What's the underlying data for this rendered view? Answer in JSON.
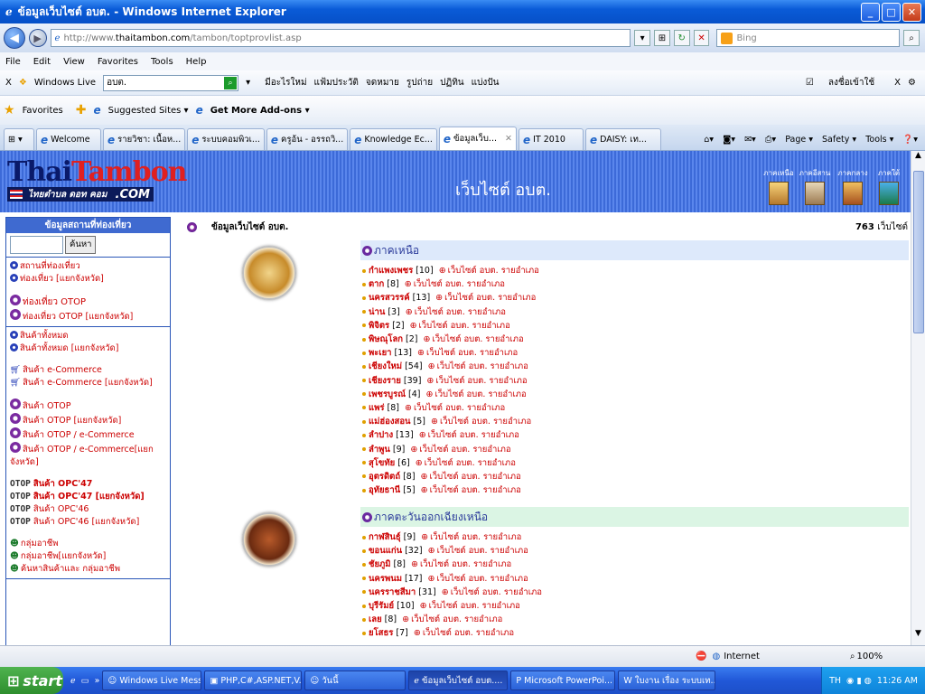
{
  "window": {
    "title": "ข้อมูลเว็บไซต์ อบต. - Windows Internet Explorer"
  },
  "address": {
    "url_prefix": "http://www.",
    "url_domain": "thaitambon.com",
    "url_path": "/tambon/toptprovlist.asp",
    "search_placeholder": "Bing"
  },
  "menu": [
    "File",
    "Edit",
    "View",
    "Favorites",
    "Tools",
    "Help"
  ],
  "wl_toolbar": {
    "brand": "Windows Live",
    "search_value": "อบต.",
    "links": [
      "มีอะไรใหม่",
      "แฟ้มประวัติ",
      "จดหมาย",
      "รูปถ่าย",
      "ปฏิทิน",
      "แบ่งปัน"
    ],
    "signin": "ลงชื่อเข้าใช้"
  },
  "favorites": {
    "label": "Favorites",
    "items": [
      "Suggested Sites ▾",
      "Get More Add-ons ▾"
    ]
  },
  "tabs": [
    "Welcome",
    "รายวิชา: เนื้อห...",
    "ระบบคอมพิวเ...",
    "ครูอ้น - อรรถวิ...",
    "Knowledge Ec...",
    "ข้อมูลเว็บ...",
    "IT 2010",
    "DAISY: เท..."
  ],
  "tab_tools": [
    "Page ▾",
    "Safety ▾",
    "Tools ▾"
  ],
  "header": {
    "logo_thai": "Thai",
    "logo_tambon": "Tambon",
    "logo_tagline": "ไทยตำบล ดอท คอม",
    "logo_com": ".COM",
    "site_title": "เว็บไซต์ อบต.",
    "regions": [
      "ภาคเหนือ",
      "ภาคอีสาน",
      "ภาคกลาง",
      "ภาคใต้"
    ]
  },
  "left": {
    "head": "ข้อมูลสถานที่ท่องเที่ยว",
    "search_btn": "ค้นหา",
    "s1": [
      "สถานที่ท่องเที่ยว",
      "ท่องเที่ยว [แยกจังหวัด]"
    ],
    "s2": [
      "ท่องเที่ยว OTOP",
      "ท่องเที่ยว OTOP [แยกจังหวัด]"
    ],
    "s3": [
      "สินค้าทั้งหมด",
      "สินค้าทั้งหมด [แยกจังหวัด]",
      "สินค้า e-Commerce",
      "สินค้า e-Commerce [แยกจังหวัด]",
      "สินค้า OTOP",
      "สินค้า OTOP [แยกจังหวัด]",
      "สินค้า OTOP / e-Commerce",
      "สินค้า OTOP / e-Commerce[แยกจังหวัด]"
    ],
    "s4": {
      "otop": "OTOP",
      "items": [
        "สินค้า OPC'47",
        "สินค้า OPC'47 [แยกจังหวัด]",
        "สินค้า OPC'46",
        "สินค้า OPC'46 [แยกจังหวัด]"
      ]
    },
    "s5": [
      "กลุ่มอาชีพ",
      "กลุ่มอาชีพ[แยกจังหวัด]",
      "ค้นหาสินค้าและ กลุ่มอาชีพ"
    ]
  },
  "main": {
    "title": "ข้อมูลเว็บไซต์ อบต.",
    "count_num": "763",
    "count_label": "เว็บไซต์",
    "link_text": "เว็บไซต์ อบต. รายอำเภอ"
  },
  "north": {
    "name": "ภาคเหนือ",
    "items": [
      {
        "p": "กำแพงเพชร",
        "n": "[10]"
      },
      {
        "p": "ตาก",
        "n": "[8]"
      },
      {
        "p": "นครสวรรค์",
        "n": "[13]"
      },
      {
        "p": "น่าน",
        "n": "[3]"
      },
      {
        "p": "พิจิตร",
        "n": "[2]"
      },
      {
        "p": "พิษณุโลก",
        "n": "[2]"
      },
      {
        "p": "พะเยา",
        "n": "[13]"
      },
      {
        "p": "เชียงใหม่",
        "n": "[54]"
      },
      {
        "p": "เชียงราย",
        "n": "[39]"
      },
      {
        "p": "เพชรบูรณ์",
        "n": "[4]"
      },
      {
        "p": "แพร่",
        "n": "[8]"
      },
      {
        "p": "แม่ฮ่องสอน",
        "n": "[5]"
      },
      {
        "p": "ลำปาง",
        "n": "[13]"
      },
      {
        "p": "ลำพูน",
        "n": "[9]"
      },
      {
        "p": "สุโขทัย",
        "n": "[6]"
      },
      {
        "p": "อุตรดิตถ์",
        "n": "[8]"
      },
      {
        "p": "อุทัยธานี",
        "n": "[5]"
      }
    ]
  },
  "northeast": {
    "name": "ภาคตะวันออกเฉียงเหนือ",
    "items": [
      {
        "p": "กาฬสินธุ์",
        "n": "[9]"
      },
      {
        "p": "ขอนแก่น",
        "n": "[32]"
      },
      {
        "p": "ชัยภูมิ",
        "n": "[8]"
      },
      {
        "p": "นครพนม",
        "n": "[17]"
      },
      {
        "p": "นครราชสีมา",
        "n": "[31]"
      },
      {
        "p": "บุรีรัมย์",
        "n": "[10]"
      },
      {
        "p": "เลย",
        "n": "[8]"
      },
      {
        "p": "ยโสธร",
        "n": "[7]"
      }
    ]
  },
  "status": {
    "zone": "Internet",
    "zoom": "100%"
  },
  "taskbar": {
    "start": "start",
    "buttons": [
      "Windows Live Mess...",
      "PHP,C#,ASP.NET,V...",
      "วันนี้",
      "ข้อมูลเว็บไซต์ อบต....",
      "Microsoft PowerPoi...",
      "ใบงาน เรื่อง ระบบเท..."
    ],
    "lang": "TH",
    "clock": "11:26 AM"
  },
  "colors": {
    "header_blue": "#4a78e2",
    "link_red": "#cc0000",
    "north_bg": "#dde9fb",
    "northeast_bg": "#dbf5e4"
  }
}
